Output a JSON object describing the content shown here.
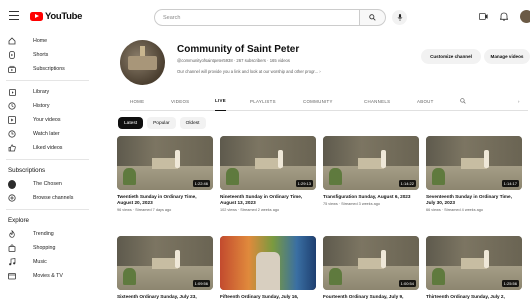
{
  "header": {
    "logo_text": "YouTube",
    "search_placeholder": "Search"
  },
  "sidebar": {
    "main_items": [
      {
        "label": "Home",
        "icon": "home-icon"
      },
      {
        "label": "Shorts",
        "icon": "shorts-icon"
      },
      {
        "label": "Subscriptions",
        "icon": "subscriptions-icon"
      }
    ],
    "library_items": [
      {
        "label": "Library",
        "icon": "library-icon"
      },
      {
        "label": "History",
        "icon": "history-icon"
      },
      {
        "label": "Your videos",
        "icon": "your-videos-icon"
      },
      {
        "label": "Watch later",
        "icon": "watch-later-icon"
      },
      {
        "label": "Liked videos",
        "icon": "liked-videos-icon"
      }
    ],
    "subscriptions_heading": "Subscriptions",
    "subscriptions": [
      {
        "label": "The Chosen"
      },
      {
        "label": "Browse channels"
      }
    ],
    "explore_heading": "Explore",
    "explore_items": [
      {
        "label": "Trending",
        "icon": "trending-icon"
      },
      {
        "label": "Shopping",
        "icon": "shopping-icon"
      },
      {
        "label": "Music",
        "icon": "music-icon"
      },
      {
        "label": "Movies & TV",
        "icon": "movies-icon"
      }
    ]
  },
  "channel": {
    "name": "Community of Saint Peter",
    "meta": "@communityofsaintpeter5938 · 267 subscribers · 165 videos",
    "description": "Our channel will provide you a link and look at our worship and other progr...",
    "customize_label": "Customize channel",
    "manage_label": "Manage videos"
  },
  "tabs": [
    {
      "label": "HOME"
    },
    {
      "label": "VIDEOS"
    },
    {
      "label": "LIVE"
    },
    {
      "label": "PLAYLISTS"
    },
    {
      "label": "COMMUNITY"
    },
    {
      "label": "CHANNELS"
    },
    {
      "label": "ABOUT"
    }
  ],
  "active_tab": "LIVE",
  "chips": [
    {
      "label": "Latest"
    },
    {
      "label": "Popular"
    },
    {
      "label": "Oldest"
    }
  ],
  "videos": [
    {
      "title": "Twentieth Sunday in Ordinary Time, August 20, 2023",
      "meta": "96 views · Streamed 7 days ago",
      "duration": "1:22:46"
    },
    {
      "title": "Nineteenth Sunday in Ordinary Time, August 13, 2023",
      "meta": "102 views · Streamed 2 weeks ago",
      "duration": "1:29:13"
    },
    {
      "title": "Transfiguration Sunday, August 6, 2023",
      "meta": "75 views · Streamed 3 weeks ago",
      "duration": "1:14:22"
    },
    {
      "title": "Seventeenth Sunday in Ordinary Time, July 30, 2023",
      "meta": "66 views · Streamed 4 weeks ago",
      "duration": "1:14:17"
    },
    {
      "title": "Sixteenth Ordinary Sunday, July 23,",
      "meta": "",
      "duration": "1:09:56"
    },
    {
      "title": "Fifteenth Ordinary Sunday, July 16,",
      "meta": "",
      "duration": ""
    },
    {
      "title": "Fourteenth Ordinary Sunday, July 9,",
      "meta": "",
      "duration": "1:00:54"
    },
    {
      "title": "Thirteenth Ordinary Sunday, July 2,",
      "meta": "",
      "duration": "1:25:56"
    }
  ]
}
